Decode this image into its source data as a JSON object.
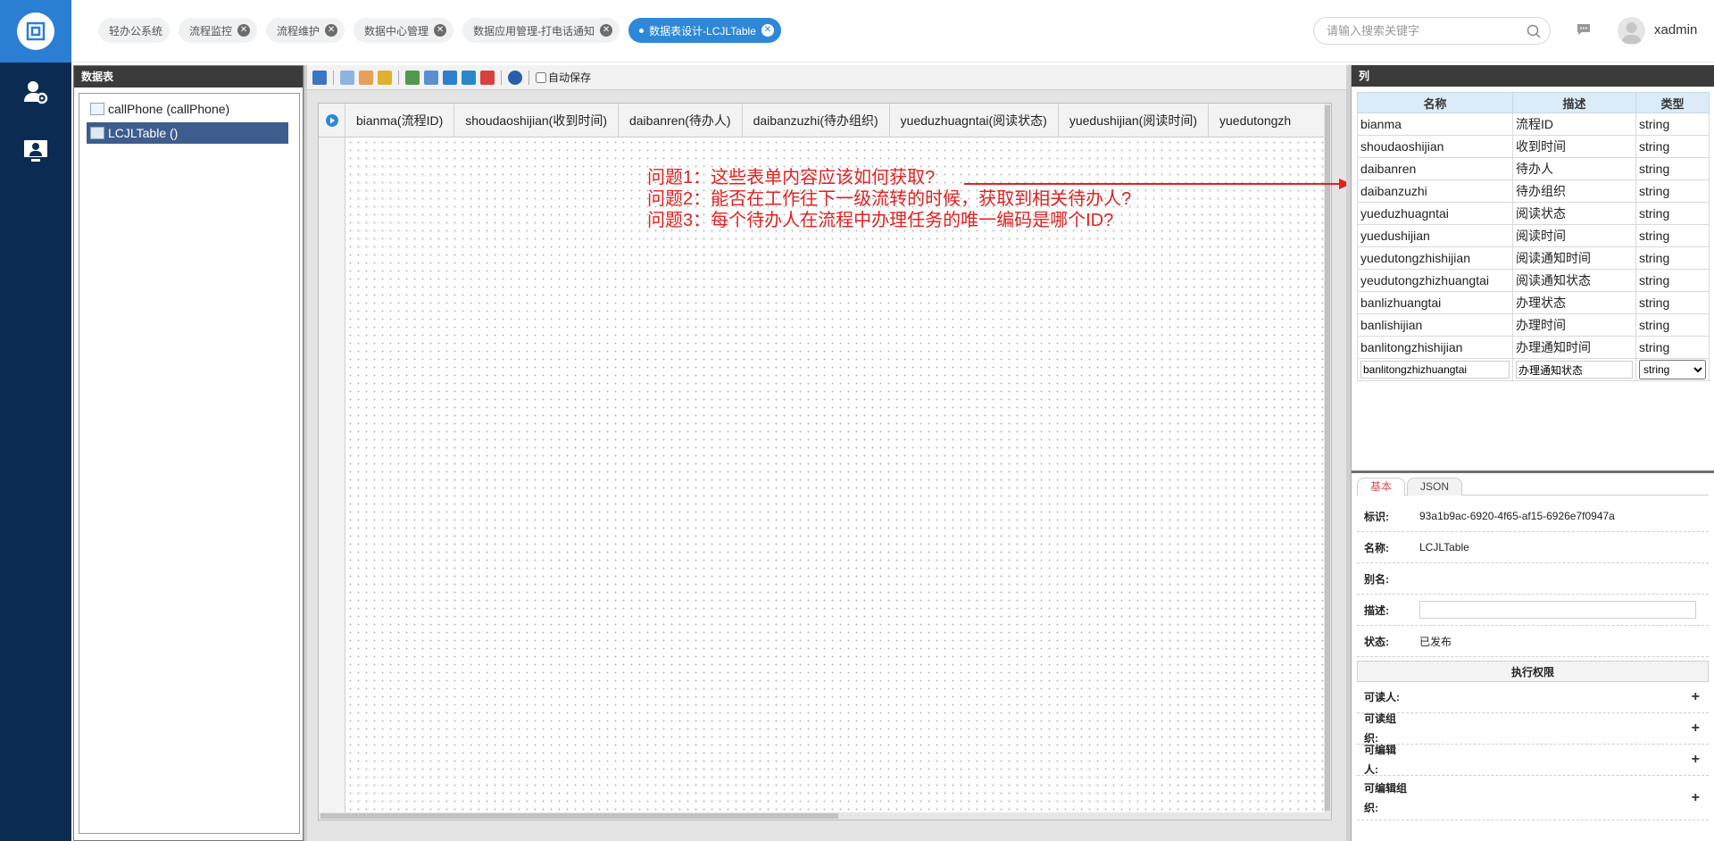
{
  "app": {
    "username": "xadmin"
  },
  "tabs": [
    {
      "label": "轻办公系统",
      "closable": false,
      "active": false
    },
    {
      "label": "流程监控",
      "closable": true,
      "active": false
    },
    {
      "label": "流程维护",
      "closable": true,
      "active": false
    },
    {
      "label": "数据中心管理",
      "closable": true,
      "active": false
    },
    {
      "label": "数据应用管理-打电话通知",
      "closable": true,
      "active": false
    },
    {
      "label": "数据表设计-LCJLTable",
      "closable": true,
      "active": true
    }
  ],
  "search": {
    "placeholder": "请输入搜索关键字"
  },
  "left_panel": {
    "title": "数据表",
    "items": [
      {
        "label": "callPhone (callPhone)",
        "selected": false
      },
      {
        "label": "LCJLTable ()",
        "selected": true
      }
    ]
  },
  "toolbar": {
    "autosave_label": "自动保存",
    "autosave_checked": false,
    "icons": [
      "save-icon",
      "copy-icon",
      "delete-icon",
      "grid-icon",
      "import-icon",
      "export-icon",
      "preview-icon",
      "excel-icon",
      "tool-icon",
      "help-icon"
    ]
  },
  "grid_columns": [
    "bianma(流程ID)",
    "shoudaoshijian(收到时间)",
    "daibanren(待办人)",
    "daibanzuzhi(待办组织)",
    "yueduzhuagntai(阅读状态)",
    "yuedushijian(阅读时间)",
    "yuedutongzh"
  ],
  "annotations": {
    "q1": "问题1：这些表单内容应该如何获取?",
    "q2": "问题2：能否在工作往下一级流转的时候，获取到相关待办人?",
    "q3": "问题3：每个待办人在流程中办理任务的唯一编码是哪个ID?",
    "color": "#e32020"
  },
  "right_panel": {
    "title": "列",
    "headers": {
      "name": "名称",
      "desc": "描述",
      "type": "类型"
    },
    "columns": [
      {
        "name": "bianma",
        "desc": "流程ID",
        "type": "string"
      },
      {
        "name": "shoudaoshijian",
        "desc": "收到时间",
        "type": "string"
      },
      {
        "name": "daibanren",
        "desc": "待办人",
        "type": "string"
      },
      {
        "name": "daibanzuzhi",
        "desc": "待办组织",
        "type": "string"
      },
      {
        "name": "yueduzhuagntai",
        "desc": "阅读状态",
        "type": "string"
      },
      {
        "name": "yuedushijian",
        "desc": "阅读时间",
        "type": "string"
      },
      {
        "name": "yuedutongzhishijian",
        "desc": "阅读通知时间",
        "type": "string"
      },
      {
        "name": "yeudutongzhizhuangtai",
        "desc": "阅读通知状态",
        "type": "string"
      },
      {
        "name": "banlizhuangtai",
        "desc": "办理状态",
        "type": "string"
      },
      {
        "name": "banlishijian",
        "desc": "办理时间",
        "type": "string"
      },
      {
        "name": "banlitongzhishijian",
        "desc": "办理通知时间",
        "type": "string"
      }
    ],
    "editing_row": {
      "name": "banlitongzhizhuangtai",
      "desc": "办理通知状态",
      "type": "string",
      "type_options": [
        "string"
      ]
    },
    "prop_tabs": [
      "基本",
      "JSON"
    ],
    "props": {
      "id_label": "标识:",
      "id_value": "93a1b9ac-6920-4f65-af15-6926e7f0947a",
      "name_label": "名称:",
      "name_value": "LCJLTable",
      "alias_label": "别名:",
      "alias_value": "",
      "desc_label": "描述:",
      "desc_value": "",
      "status_label": "状态:",
      "status_value": "已发布"
    },
    "permissions": {
      "title": "执行权限",
      "items": [
        "可读人:",
        "可读组织:",
        "可编辑人:",
        "可编辑组织:"
      ]
    }
  },
  "colors": {
    "nav_bg": "#0c2b52",
    "logo_bg": "#2a7fd4",
    "active_tab": "#2e88d9",
    "header_blue": "#dcebf8"
  }
}
